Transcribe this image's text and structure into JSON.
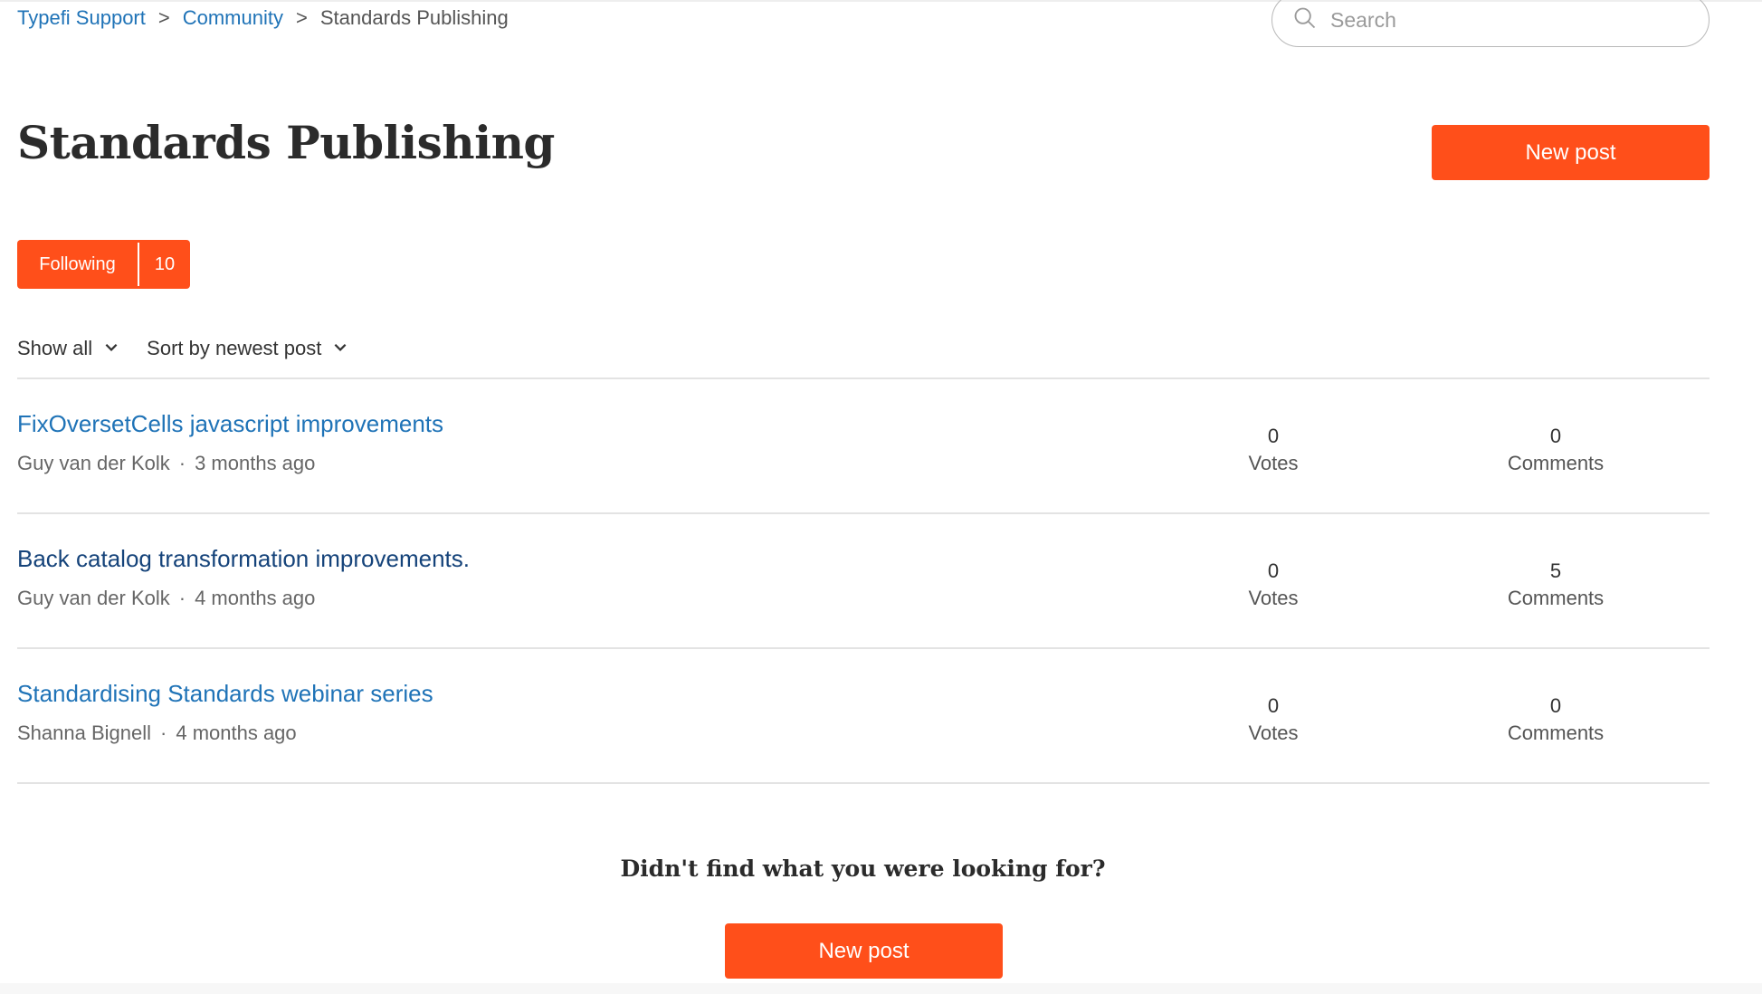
{
  "breadcrumb": {
    "items": [
      "Typefi Support",
      "Community",
      "Standards Publishing"
    ],
    "separator": ">"
  },
  "search": {
    "placeholder": "Search"
  },
  "page_title": "Standards Publishing",
  "new_post_label": "New post",
  "following": {
    "label": "Following",
    "count": "10"
  },
  "filters": {
    "show": "Show all",
    "sort": "Sort by newest post"
  },
  "posts": [
    {
      "title": "FixOversetCells javascript improvements",
      "author": "Guy van der Kolk",
      "time": "3 months ago",
      "votes": "0",
      "votes_label": "Votes",
      "comments": "0",
      "comments_label": "Comments"
    },
    {
      "title": "Back catalog transformation improvements.",
      "author": "Guy van der Kolk",
      "time": "4 months ago",
      "votes": "0",
      "votes_label": "Votes",
      "comments": "5",
      "comments_label": "Comments"
    },
    {
      "title": "Standardising Standards webinar series",
      "author": "Shanna Bignell",
      "time": "4 months ago",
      "votes": "0",
      "votes_label": "Votes",
      "comments": "0",
      "comments_label": "Comments"
    }
  ],
  "meta_separator": "·",
  "not_found_text": "Didn't find what you were looking for?",
  "colors": {
    "accent": "#ff4f1a",
    "link": "#1f73b7",
    "visited_link": "#15437a",
    "divider": "#e3e3e3"
  },
  "icons": {
    "search": "search-icon",
    "dropdown": "chevron-down-icon"
  }
}
